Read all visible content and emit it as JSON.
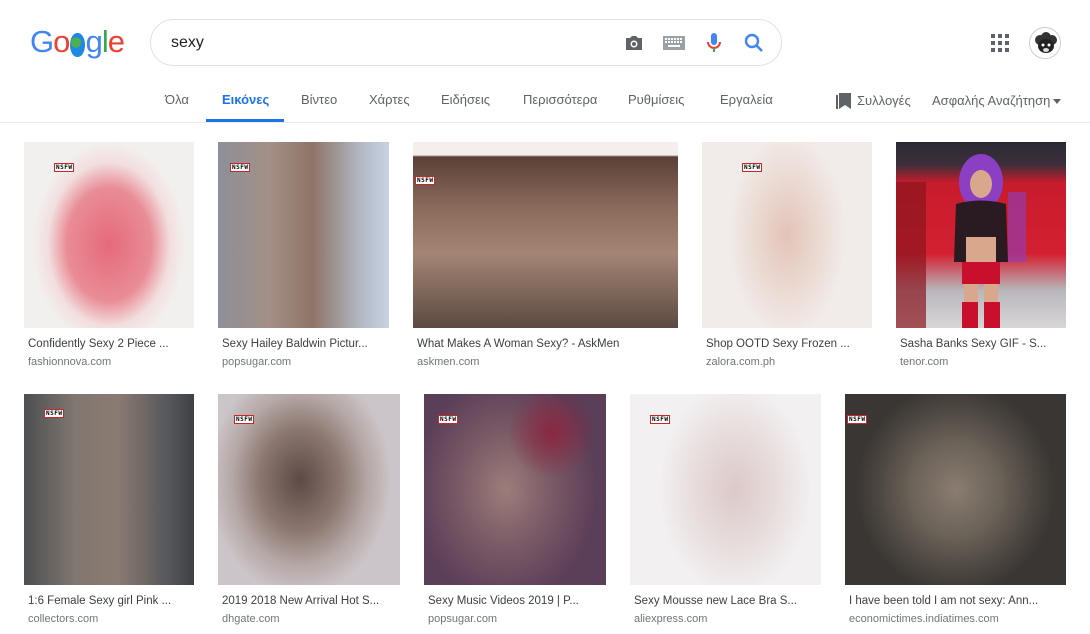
{
  "header": {
    "logo_letters": [
      "G",
      "o",
      "g",
      "l",
      "e"
    ],
    "search_value": "sexy"
  },
  "search_icons": [
    "camera-icon",
    "keyboard-icon",
    "microphone-icon",
    "search-icon"
  ],
  "colors": {
    "active_tab": "#1a73e8",
    "logo_blue": "#4285f4",
    "logo_red": "#ea4335",
    "logo_yellow": "#fbbc05",
    "logo_green": "#34a853"
  },
  "tabs": [
    {
      "label": "Όλα",
      "active": false
    },
    {
      "label": "Εικόνες",
      "active": true
    },
    {
      "label": "Βίντεο",
      "active": false
    },
    {
      "label": "Χάρτες",
      "active": false
    },
    {
      "label": "Ειδήσεις",
      "active": false
    },
    {
      "label": "Περισσότερα",
      "active": false
    },
    {
      "label": "Ρυθμίσεις",
      "active": false
    },
    {
      "label": "Εργαλεία",
      "active": false
    }
  ],
  "tabs_right": {
    "collections": "Συλλογές",
    "safesearch": "Ασφαλής Αναζήτηση"
  },
  "nsfw_label": "NSFW",
  "results": [
    {
      "caption": "Confidently Sexy 2 Piece ...",
      "source": "fashionnova.com"
    },
    {
      "caption": "Sexy Hailey Baldwin Pictur...",
      "source": "popsugar.com"
    },
    {
      "caption": "What Makes A Woman Sexy? - AskMen",
      "source": "askmen.com"
    },
    {
      "caption": "Shop OOTD Sexy Frozen ...",
      "source": "zalora.com.ph"
    },
    {
      "caption": "Sasha Banks Sexy GIF - S...",
      "source": "tenor.com"
    },
    {
      "caption": "1:6 Female Sexy girl Pink ...",
      "source": "collectors.com"
    },
    {
      "caption": "2019 2018 New Arrival Hot S...",
      "source": "dhgate.com"
    },
    {
      "caption": "Sexy Music Videos 2019 | P...",
      "source": "popsugar.com"
    },
    {
      "caption": "Sexy Mousse new Lace Bra S...",
      "source": "aliexpress.com"
    },
    {
      "caption": "I have been told I am not sexy: Ann...",
      "source": "economictimes.indiatimes.com"
    }
  ]
}
